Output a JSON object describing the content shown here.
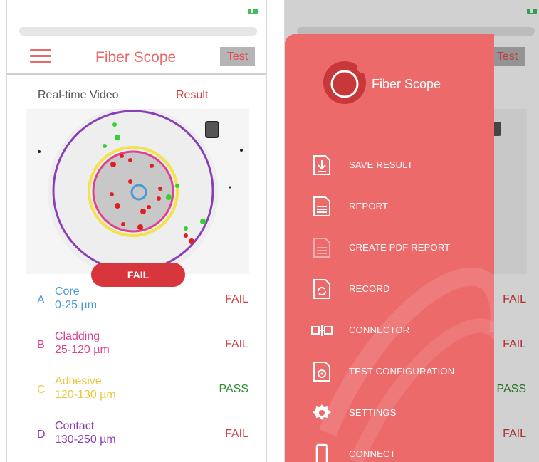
{
  "app": {
    "title": "Fiber Scope",
    "test_label": "Test"
  },
  "tabs": {
    "video": "Real-time Video",
    "result": "Result"
  },
  "overall_status": "FAIL",
  "zones": [
    {
      "letter": "A",
      "name": "Core",
      "range": "0-25 µm",
      "status": "FAIL",
      "color": "#4a9ad8",
      "status_color": "#d83a3a"
    },
    {
      "letter": "B",
      "name": "Cladding",
      "range": "25-120 µm",
      "status": "FAIL",
      "color": "#e0418f",
      "status_color": "#d83a3a"
    },
    {
      "letter": "C",
      "name": "Adhesive",
      "range": "120-130 µm",
      "status": "PASS",
      "color": "#e8c83c",
      "status_color": "#2e8b2e"
    },
    {
      "letter": "D",
      "name": "Contact",
      "range": "130-250 µm",
      "status": "FAIL",
      "color": "#8a3fb8",
      "status_color": "#d83a3a"
    }
  ],
  "drawer": {
    "title": "Fiber Scope",
    "items": [
      {
        "label": "SAVE RESULT",
        "icon": "save-icon"
      },
      {
        "label": "REPORT",
        "icon": "report-icon"
      },
      {
        "label": "CREATE PDF REPORT",
        "icon": "pdf-report-icon"
      },
      {
        "label": "RECORD",
        "icon": "record-icon"
      },
      {
        "label": "CONNECTOR",
        "icon": "connector-icon"
      },
      {
        "label": "TEST CONFIGURATION",
        "icon": "test-configuration-icon"
      },
      {
        "label": "SETTINGS",
        "icon": "gear-icon"
      },
      {
        "label": "CONNECT",
        "icon": "phone-icon"
      }
    ]
  },
  "colors": {
    "accent": "#e86a6a",
    "drawer": "#ec6a6a",
    "fail": "#d83a3a",
    "pass": "#2e8b2e",
    "banner": "#d8363d"
  }
}
